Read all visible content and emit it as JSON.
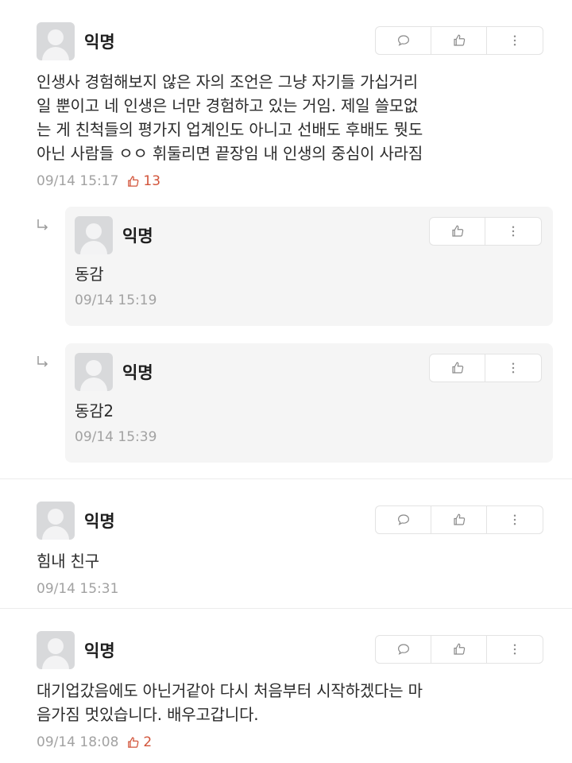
{
  "comments": [
    {
      "author": "익명",
      "text": "인생사 경험해보지 않은 자의 조언은 그냥 자기들 가십거리\n일 뿐이고 네 인생은 너만 경험하고 있는 거임. 제일 쓸모없\n는 게 친척들의 평가지 업계인도 아니고 선배도 후배도 뭣도\n아닌 사람들 ㅇㅇ 휘둘리면 끝장임 내 인생의 중심이 사라짐",
      "time": "09/14 15:17",
      "likes": "13"
    },
    {
      "author": "익명",
      "text": "힘내 친구",
      "time": "09/14 15:31",
      "likes": ""
    },
    {
      "author": "익명",
      "text": "대기업갔음에도 아닌거같아 다시 처음부터 시작하겠다는 마\n음가짐 멋있습니다. 배우고갑니다.",
      "time": "09/14 18:08",
      "likes": "2"
    }
  ],
  "replies": [
    {
      "author": "익명",
      "text": "동감",
      "time": "09/14 15:19"
    },
    {
      "author": "익명",
      "text": "동감2",
      "time": "09/14 15:39"
    }
  ],
  "icons": {
    "comment": "speech-bubble-icon",
    "like": "thumbs-up-icon",
    "more": "more-vertical-icon",
    "reply": "reply-arrow-icon"
  },
  "colors": {
    "like_count": "#d2543a",
    "meta": "#a2a2a2",
    "reply_bg": "#f5f5f5"
  }
}
